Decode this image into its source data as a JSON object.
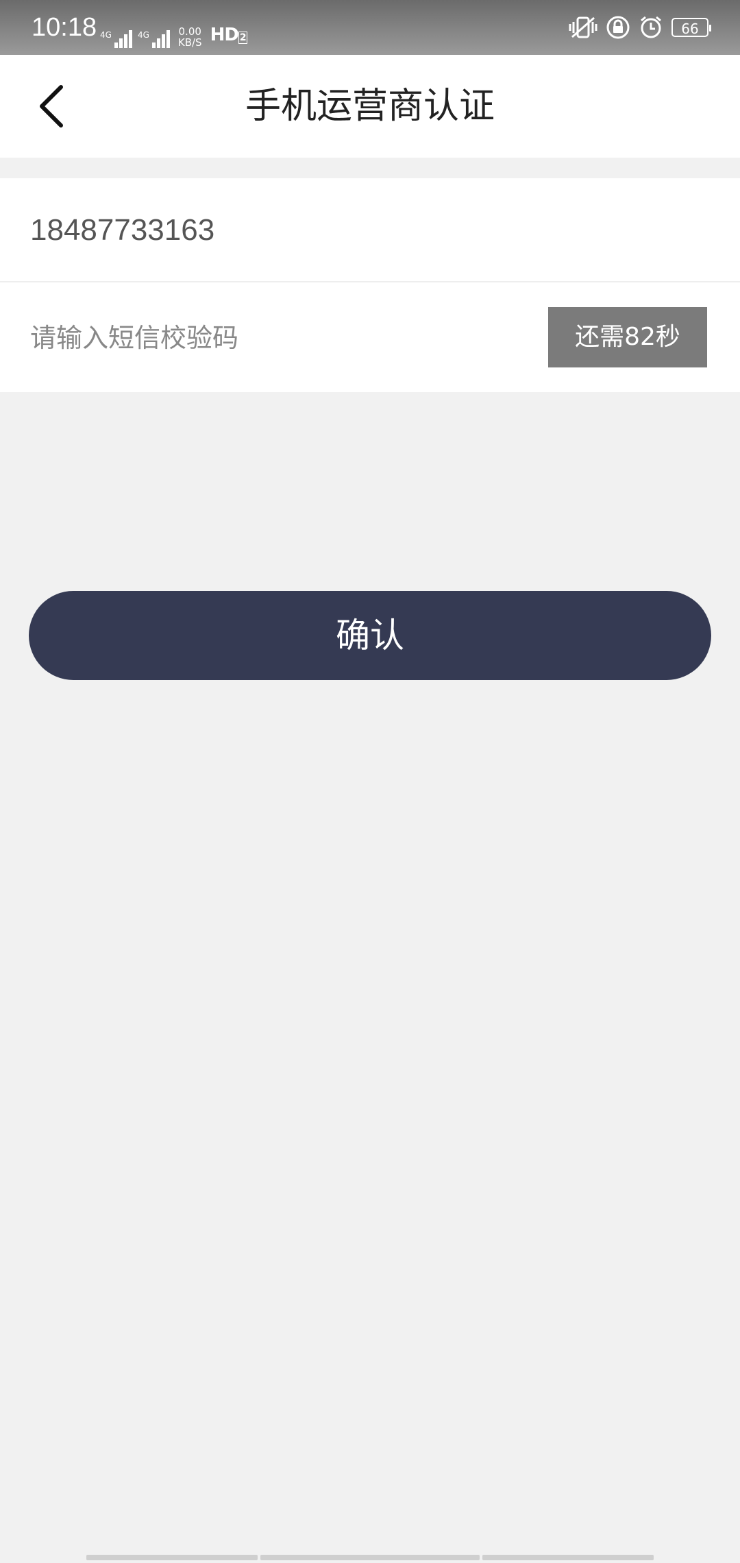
{
  "status_bar": {
    "time": "10:18",
    "signal1_label": "4G",
    "signal2_label": "4G",
    "speed_value": "0.00",
    "speed_unit": "KB/S",
    "hd_label": "HD",
    "hd_sub": "2",
    "battery": "66"
  },
  "header": {
    "title": "手机运营商认证"
  },
  "form": {
    "phone": "18487733163",
    "code_placeholder": "请输入短信校验码",
    "countdown_label": "还需82秒"
  },
  "actions": {
    "confirm_label": "确认"
  },
  "colors": {
    "primary": "#353a53",
    "countdown_bg": "#7b7b7b",
    "background": "#f1f1f1"
  }
}
